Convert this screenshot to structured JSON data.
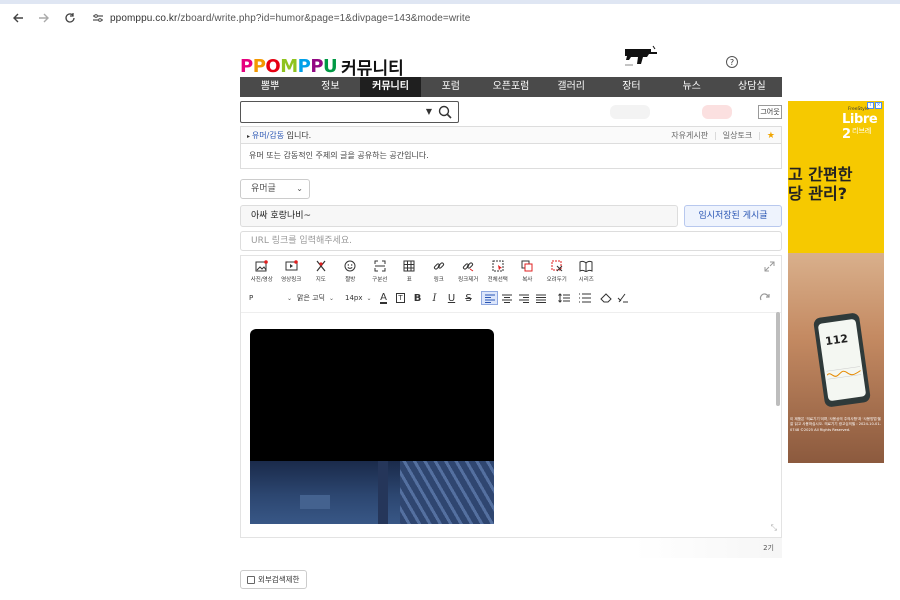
{
  "browser": {
    "url_host": "ppomppu.co.kr",
    "url_path": "/zboard/write.php?id=humor&page=1&divpage=143&mode=write"
  },
  "header": {
    "logo_letters": [
      "P",
      "P",
      "O",
      "M",
      "P",
      "P",
      "U"
    ],
    "logo_sub": "커뮤니티",
    "help_symbol": "?"
  },
  "nav": {
    "items": [
      "뽐뿌",
      "정보",
      "커뮤니티",
      "포럼",
      "오픈포럼",
      "갤러리",
      "장터",
      "뉴스",
      "상담실"
    ],
    "active": "커뮤니티"
  },
  "search": {
    "mini_button": "그어웃"
  },
  "board": {
    "name_link": "유머/감동",
    "name_suffix": " 입니다.",
    "right_links": [
      "자유게시판",
      "일상토크"
    ],
    "description": "유머 또는 감동적인 주제의 글을 공유하는 공간입니다."
  },
  "form": {
    "category": "유머글",
    "title_value": "아싸 호랑나비~",
    "temp_saved_button": "임시저장된 게시글",
    "url_placeholder": "URL 링크를 입력해주세요."
  },
  "editor": {
    "tools": [
      {
        "icon": "photo-icon",
        "label": "사진/영상"
      },
      {
        "icon": "video-link-icon",
        "label": "영상링크"
      },
      {
        "icon": "map-icon",
        "label": "지도"
      },
      {
        "icon": "emoji-icon",
        "label": "짤방"
      },
      {
        "icon": "divider-icon",
        "label": "구분선"
      },
      {
        "icon": "table-icon",
        "label": "표"
      },
      {
        "icon": "link-icon",
        "label": "링크"
      },
      {
        "icon": "unlink-icon",
        "label": "링크제거"
      },
      {
        "icon": "select-all-icon",
        "label": "전체선택"
      },
      {
        "icon": "copy-icon",
        "label": "복사"
      },
      {
        "icon": "cut-icon",
        "label": "오려두기"
      },
      {
        "icon": "series-icon",
        "label": "시리즈"
      }
    ],
    "paragraph": "P",
    "font": "맑은 고딕",
    "size": "14px",
    "char_counter_tail": "2기"
  },
  "options": {
    "external_search_block": "외부검색제한"
  },
  "ad": {
    "brand_small": "FreeStyle",
    "brand": "Libre 2",
    "brand_kr": "리브레",
    "headline_line1": "고 간편한",
    "headline_line2": "당 관리?",
    "reading": "112",
    "disclaimer": "이 제품은 '의료기기'이며,'사용상의 주의사항'과 '사용방법'을 잘 읽고 사용하십시오. 의료기기 광고심의필 : 2024-10-01-0748 ©2025 All Rights Reserved."
  }
}
